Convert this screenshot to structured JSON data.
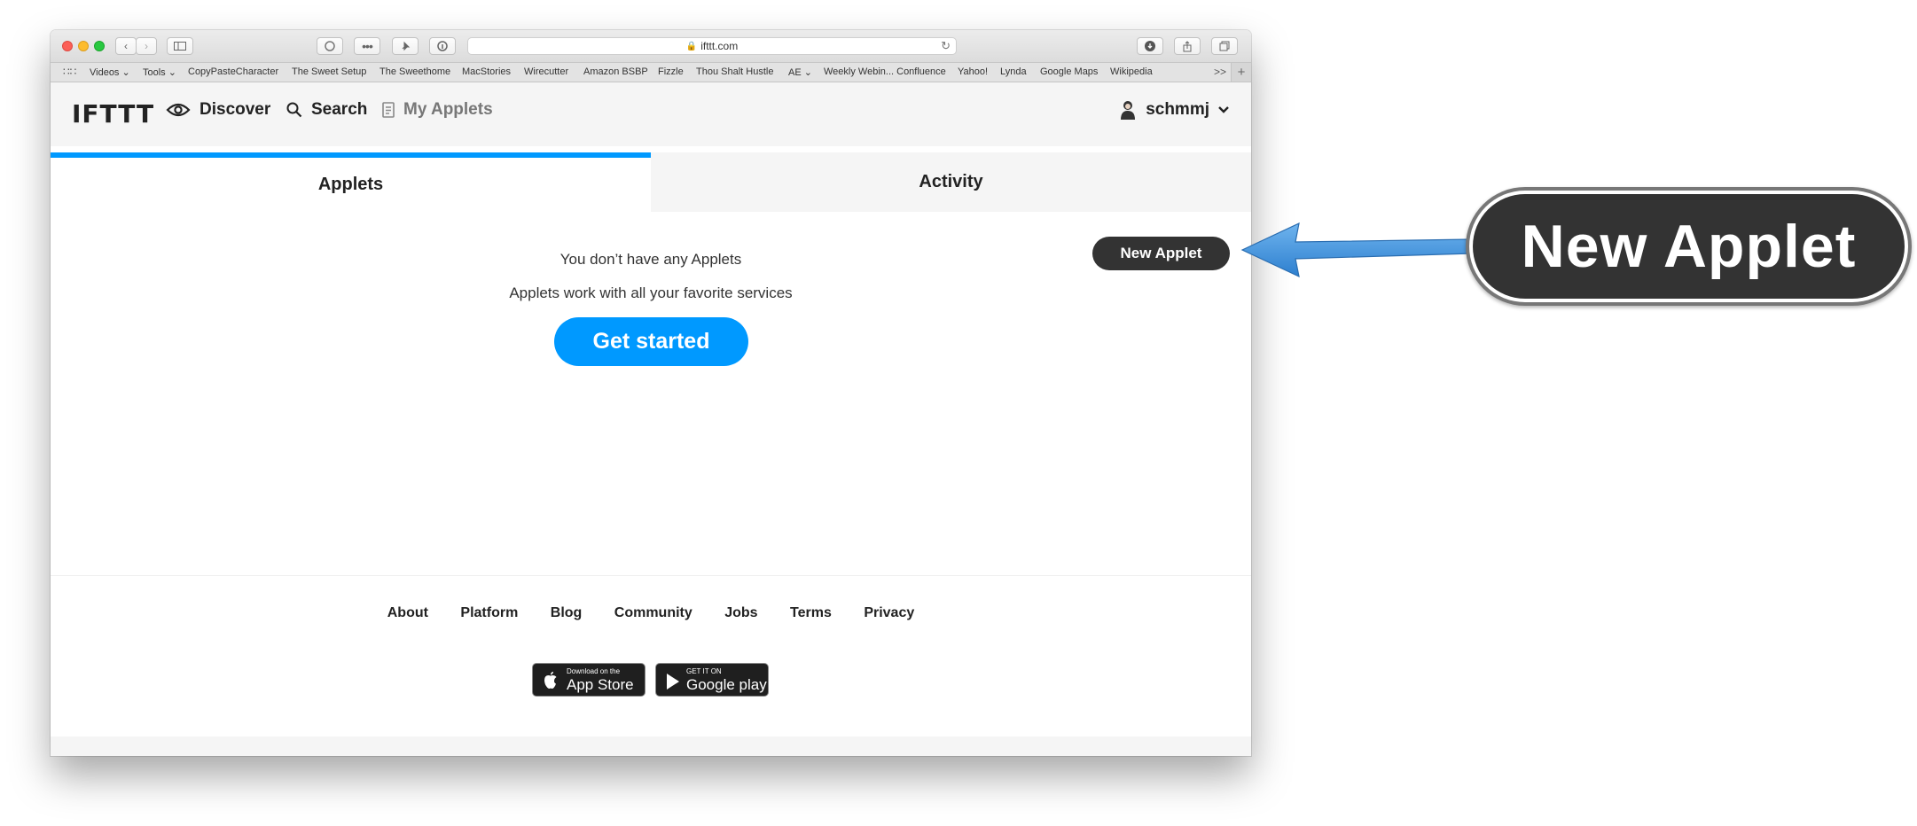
{
  "browser": {
    "url": "ifttt.com",
    "bookmarks": [
      "Videos ⌄",
      "Tools ⌄",
      "CopyPasteCharacter",
      "The Sweet Setup",
      "The Sweethome",
      "MacStories",
      "Wirecutter",
      "Amazon BSBP",
      "Fizzle",
      "Thou Shalt Hustle",
      "AE ⌄",
      "Weekly Webin... Confluence",
      "Yahoo!",
      "Lynda",
      "Google Maps",
      "Wikipedia"
    ],
    "more": ">>",
    "plus": "+"
  },
  "header": {
    "logo": "IFTTT",
    "nav": [
      "Discover",
      "Search",
      "My Applets"
    ],
    "username": "schmmj"
  },
  "tabs": [
    "Applets",
    "Activity"
  ],
  "content": {
    "new_applet": "New Applet",
    "empty_title": "You don’t have any Applets",
    "empty_subtitle": "Applets work with all your favorite services",
    "get_started": "Get started"
  },
  "footer": {
    "links": [
      "About",
      "Platform",
      "Blog",
      "Community",
      "Jobs",
      "Terms",
      "Privacy"
    ],
    "app_store": {
      "small": "Download on the",
      "big": "App Store"
    },
    "google_play": {
      "small": "GET IT ON",
      "big": "Google play"
    }
  },
  "callout": {
    "label": "New Applet"
  },
  "colors": {
    "accent": "#0099ff",
    "dark_button": "#333333",
    "callout_arrow": "#3d8fd8"
  }
}
